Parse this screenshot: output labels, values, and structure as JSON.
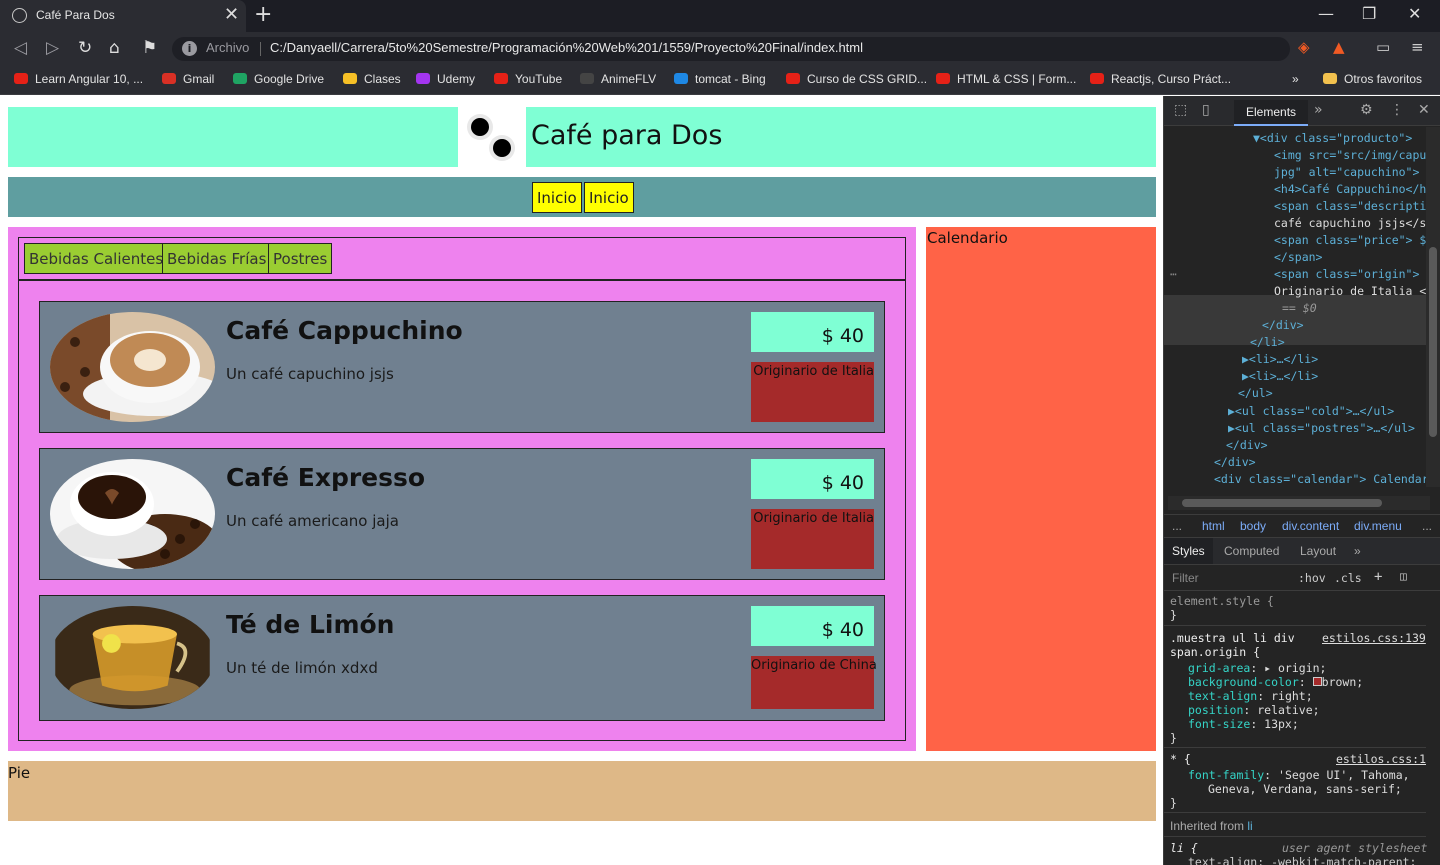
{
  "browser": {
    "tab_title": "Café Para Dos",
    "new_tab": "+",
    "close_tab": "✕",
    "window_controls": [
      "—",
      "❐",
      "✕"
    ],
    "address_label": "Archivo",
    "url": "C:/Danyaell/Carrera/5to%20Semestre/Programación%20Web%201/1559/Proyecto%20Final/index.html",
    "bookmarks": [
      {
        "label": "Learn Angular 10, ...",
        "color": "#e62117"
      },
      {
        "label": "Gmail",
        "color": "#d93025"
      },
      {
        "label": "Google Drive",
        "color": "#1fa463"
      },
      {
        "label": "Clases",
        "color": "#f6c026"
      },
      {
        "label": "Udemy",
        "color": "#a435f0"
      },
      {
        "label": "YouTube",
        "color": "#e62117"
      },
      {
        "label": "AnimeFLV",
        "color": "#444444"
      },
      {
        "label": "tomcat - Bing",
        "color": "#1e88e5"
      },
      {
        "label": "Curso de CSS GRID...",
        "color": "#e62117"
      },
      {
        "label": "HTML & CSS | Form...",
        "color": "#e62117"
      },
      {
        "label": "Reactjs, Curso Práct...",
        "color": "#e62117"
      }
    ],
    "more_bookmarks": "»",
    "other_favorites": "Otros favoritos"
  },
  "page": {
    "title": "Café para Dos",
    "nav": [
      "Inicio",
      "Inicio"
    ],
    "categories": [
      "Bebidas Calientes",
      "Bebidas Frías",
      "Postres"
    ],
    "products": [
      {
        "name": "Café Cappuchino",
        "description": "Un café capuchino jsjs",
        "price": "$ 40",
        "origin": "Originario de Italia",
        "image": "cappuccino-image"
      },
      {
        "name": "Café Expresso",
        "description": "Un café americano jaja",
        "price": "$ 40",
        "origin": "Originario de Italia",
        "image": "espresso-image"
      },
      {
        "name": "Té de Limón",
        "description": "Un té de limón xdxd",
        "price": "$ 40",
        "origin": "Originario de China",
        "image": "lemon-tea-image"
      }
    ],
    "calendar": "Calendario",
    "footer": "Pie",
    "colors": {
      "header": "#7fffd4",
      "nav": "#5f9ea0",
      "content": "#ee82ee",
      "calendar": "#ff6347",
      "footer": "#deb887",
      "card": "#708090",
      "origin": "#a52a2a",
      "tab": "#9acd32",
      "navbtn": "#ffff00"
    }
  },
  "devtools": {
    "tab_elements": "Elements",
    "dom_lines": [
      "▼<div class=\"producto\">",
      "<img src=\"src/img/capuc",
      "jpg\" alt=\"capuchino\">",
      "<h4>Café Cappuchino</h4",
      "<span class=\"descripti",
      "café capuchino jsjs</sp",
      "<span class=\"price\"> $",
      "</span>",
      "<span class=\"origin\">",
      "Originario de Italia </",
      "== $0",
      "</div>",
      "</li>",
      "▶<li>…</li>",
      "▶<li>…</li>",
      "</ul>",
      "▶<ul class=\"cold\">…</ul>",
      "▶<ul class=\"postres\">…</ul>",
      "</div>",
      "</div>",
      "<div class=\"calendar\"> Calendari"
    ],
    "breadcrumbs": [
      "...",
      "html",
      "body",
      "div.content",
      "div.menu",
      "..."
    ],
    "style_tabs": [
      "Styles",
      "Computed",
      "Layout",
      "»"
    ],
    "filter_placeholder": "Filter",
    "hov": ":hov",
    "cls": ".cls",
    "rules": {
      "element_style": "element.style {",
      "close": "}",
      "sel1a": ".muestra ul li div",
      "sel1b": "span.origin {",
      "src1": "estilos.css:139",
      "decl1": [
        "grid-area: ▸ origin;",
        "background-color: ■brown;",
        "text-align: right;",
        "position: relative;",
        "font-size: 13px;"
      ],
      "sel2": "* {",
      "src2": "estilos.css:1",
      "decl2a": "font-family: 'Segoe UI', Tahoma,",
      "decl2b": "Geneva, Verdana, sans-serif;",
      "inherited": "Inherited from",
      "inherited_from": "li",
      "sel3": "li {",
      "src3": "user agent stylesheet",
      "decl3": "text-align: -webkit-match-parent;"
    }
  }
}
